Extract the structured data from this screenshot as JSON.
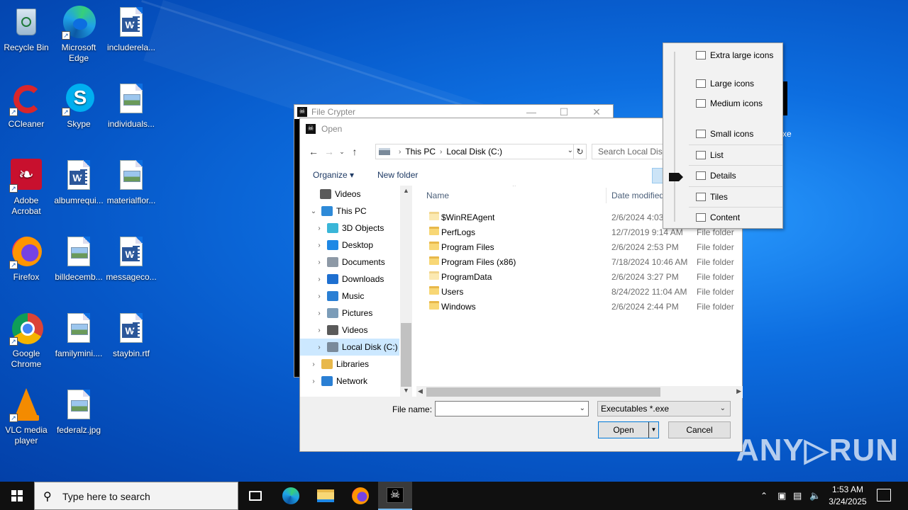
{
  "desktop": {
    "icons": [
      {
        "label": "Recycle Bin",
        "icon": "recycle-bin-icon"
      },
      {
        "label": "Microsoft Edge",
        "icon": "edge-icon"
      },
      {
        "label": "includerela...",
        "icon": "word-doc-icon"
      },
      {
        "label": "CCleaner",
        "icon": "ccleaner-icon"
      },
      {
        "label": "Skype",
        "icon": "skype-icon"
      },
      {
        "label": "individuals...",
        "icon": "image-file-icon"
      },
      {
        "label": "Adobe Acrobat",
        "icon": "acrobat-icon"
      },
      {
        "label": "albumrequi...",
        "icon": "word-doc-icon"
      },
      {
        "label": "materialflor...",
        "icon": "image-file-icon"
      },
      {
        "label": "Firefox",
        "icon": "firefox-icon"
      },
      {
        "label": "billdecemb...",
        "icon": "image-file-icon"
      },
      {
        "label": "messageco...",
        "icon": "word-doc-icon"
      },
      {
        "label": "Google Chrome",
        "icon": "chrome-icon"
      },
      {
        "label": "familymini....",
        "icon": "image-file-icon"
      },
      {
        "label": "staybin.rtf",
        "icon": "word-doc-icon"
      },
      {
        "label": "VLC media player",
        "icon": "vlc-icon"
      },
      {
        "label": "federalz.jpg",
        "icon": "image-file-icon"
      }
    ],
    "partial_label": "xe"
  },
  "file_crypter": {
    "title": "File Crypter",
    "minimize": "—",
    "maximize": "☐",
    "close": "✕"
  },
  "open_dialog": {
    "title": "Open",
    "address": {
      "crumbs": [
        "This PC",
        "Local Disk (C:)"
      ]
    },
    "search_placeholder": "Search Local Disk (C:)",
    "toolbar": {
      "organize": "Organize ▾",
      "new_folder": "New folder"
    },
    "nav_items": [
      {
        "label": "Videos",
        "indent": 1,
        "chev": "",
        "color": "#5a5a5a"
      },
      {
        "label": "This PC",
        "indent": 0,
        "chev": "⌄",
        "color": "#2e8ad8"
      },
      {
        "label": "3D Objects",
        "indent": 1,
        "chev": "›",
        "color": "#3ab6d8"
      },
      {
        "label": "Desktop",
        "indent": 1,
        "chev": "›",
        "color": "#1e88e5"
      },
      {
        "label": "Documents",
        "indent": 1,
        "chev": "›",
        "color": "#8d99a6"
      },
      {
        "label": "Downloads",
        "indent": 1,
        "chev": "›",
        "color": "#1e6fd0"
      },
      {
        "label": "Music",
        "indent": 1,
        "chev": "›",
        "color": "#2a7fd4"
      },
      {
        "label": "Pictures",
        "indent": 1,
        "chev": "›",
        "color": "#7b9cb8"
      },
      {
        "label": "Videos",
        "indent": 1,
        "chev": "›",
        "color": "#5a5a5a"
      },
      {
        "label": "Local Disk (C:)",
        "indent": 1,
        "chev": "›",
        "color": "#7a8a9a",
        "selected": true
      },
      {
        "label": "Libraries",
        "indent": 0,
        "chev": "›",
        "color": "#e8b84a"
      },
      {
        "label": "Network",
        "indent": 0,
        "chev": "›",
        "color": "#2a7fd4"
      }
    ],
    "columns": {
      "name": "Name",
      "date": "Date modified"
    },
    "files": [
      {
        "name": "$WinREAgent",
        "date": "2/6/2024 4:03",
        "type": "",
        "light": true
      },
      {
        "name": "PerfLogs",
        "date": "12/7/2019 9:14 AM",
        "type": "File folder"
      },
      {
        "name": "Program Files",
        "date": "2/6/2024 2:53 PM",
        "type": "File folder"
      },
      {
        "name": "Program Files (x86)",
        "date": "7/18/2024 10:46 AM",
        "type": "File folder"
      },
      {
        "name": "ProgramData",
        "date": "2/6/2024 3:27 PM",
        "type": "File folder",
        "light": true
      },
      {
        "name": "Users",
        "date": "8/24/2022 11:04 AM",
        "type": "File folder"
      },
      {
        "name": "Windows",
        "date": "2/6/2024 2:44 PM",
        "type": "File folder"
      }
    ],
    "footer": {
      "file_name_label": "File name:",
      "file_name_value": "",
      "file_type": "Executables *.exe",
      "open": "Open",
      "cancel": "Cancel"
    }
  },
  "view_menu": {
    "items": [
      {
        "label": "Extra large icons",
        "icon": "extra-large-icons-icon"
      },
      {
        "label": "Large icons",
        "icon": "large-icons-icon"
      },
      {
        "label": "Medium icons",
        "icon": "medium-icons-icon"
      },
      {
        "label": "Small icons",
        "icon": "small-icons-icon"
      },
      {
        "label": "List",
        "icon": "list-icon"
      },
      {
        "label": "Details",
        "icon": "details-icon",
        "selected": true
      },
      {
        "label": "Tiles",
        "icon": "tiles-icon"
      },
      {
        "label": "Content",
        "icon": "content-icon"
      }
    ]
  },
  "watermark": "ANY▷RUN",
  "taskbar": {
    "search_placeholder": "Type here to search",
    "apps": [
      "task-view-icon",
      "edge-icon",
      "file-explorer-icon",
      "firefox-icon",
      "file-crypter-icon"
    ],
    "time": "1:53 AM",
    "date": "3/24/2025"
  },
  "colors": {
    "accent": "#0078d7",
    "desktop_bg": "#0d6ee0",
    "taskbar": "#101010"
  }
}
